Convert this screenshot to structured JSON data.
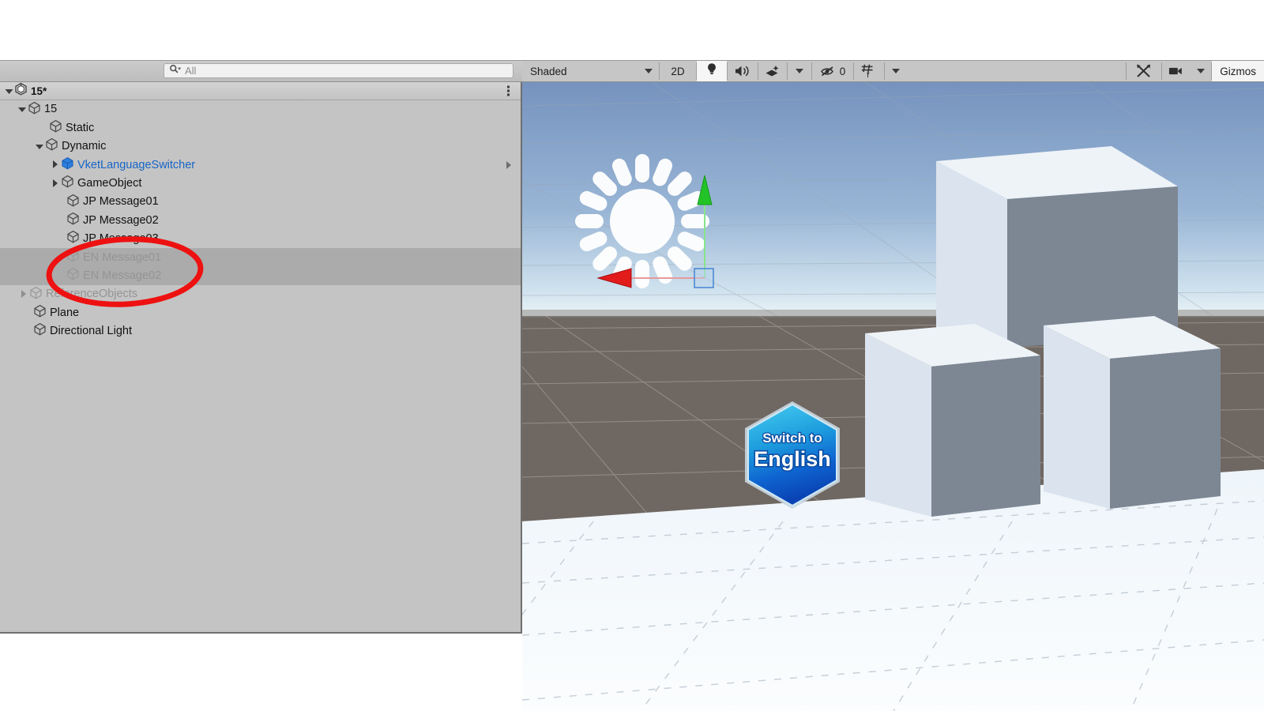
{
  "hierarchy_panel": {
    "search": {
      "value": "All",
      "placeholder": "All",
      "icon": "search-icon"
    },
    "scene_header": {
      "title": "15*",
      "icon": "unity-scene-icon",
      "menu_icon": "kebab-menu-icon"
    },
    "items": [
      {
        "label": "15",
        "indent": 22,
        "twisty": "down",
        "state": "normal",
        "icon": "gameobject-cube-icon"
      },
      {
        "label": "Static",
        "indent": 62,
        "twisty": "none",
        "state": "normal",
        "icon": "gameobject-cube-icon"
      },
      {
        "label": "Dynamic",
        "indent": 44,
        "twisty": "down",
        "state": "normal",
        "icon": "gameobject-cube-icon"
      },
      {
        "label": "VketLanguageSwitcher",
        "indent": 64,
        "twisty": "right",
        "state": "prefab",
        "icon": "prefab-cube-icon"
      },
      {
        "label": "GameObject",
        "indent": 64,
        "twisty": "right",
        "state": "normal",
        "icon": "gameobject-cube-icon"
      },
      {
        "label": "JP Message01",
        "indent": 84,
        "twisty": "none",
        "state": "normal",
        "icon": "gameobject-cube-icon"
      },
      {
        "label": "JP Message02",
        "indent": 84,
        "twisty": "none",
        "state": "normal",
        "icon": "gameobject-cube-icon"
      },
      {
        "label": "JP Message03",
        "indent": 84,
        "twisty": "none",
        "state": "normal",
        "icon": "gameobject-cube-icon"
      },
      {
        "label": "EN Message01",
        "indent": 84,
        "twisty": "none",
        "state": "disabled-selected",
        "icon": "gameobject-cube-icon"
      },
      {
        "label": "EN Message02",
        "indent": 84,
        "twisty": "none",
        "state": "disabled-selected",
        "icon": "gameobject-cube-icon"
      },
      {
        "label": "ReferenceObjects",
        "indent": 24,
        "twisty": "right",
        "state": "disabled",
        "icon": "gameobject-cube-icon"
      },
      {
        "label": "Plane",
        "indent": 42,
        "twisty": "none",
        "state": "normal",
        "icon": "gameobject-cube-icon"
      },
      {
        "label": "Directional Light",
        "indent": 42,
        "twisty": "none",
        "state": "normal",
        "icon": "gameobject-cube-icon"
      }
    ]
  },
  "scene_toolbar": {
    "shading_mode": "Shaded",
    "view_mode_2d": "2D",
    "lighting_icon": "lightbulb-icon",
    "audio_icon": "speaker-icon",
    "effects_icon": "fx-layers-icon",
    "effects_dropdown_icon": "chevron-down-icon",
    "hidden_objects_icon": "eye-slash-icon",
    "hidden_objects_count": "0",
    "grid_icon": "grid-snap-icon",
    "grid_dropdown_icon": "chevron-down-icon",
    "tools_icon": "tools-icon",
    "camera_icon": "camera-icon",
    "camera_dropdown_icon": "chevron-down-icon",
    "gizmos_label": "Gizmos"
  },
  "scene_view": {
    "light_gizmo_icon": "directional-light-sun-icon",
    "move_gizmo": {
      "y_axis_color": "#26c42a",
      "x_axis_color": "#e02020"
    },
    "hex_button": {
      "line1": "Switch to",
      "line2": "English",
      "color_top": "#3bc0e8",
      "color_bottom": "#0a4fc8"
    },
    "sky_top_color": "#7593be",
    "sky_horizon_color": "#dfeaf2",
    "ground_color": "#6f6761",
    "plane_color": "#f4f8fb",
    "cube_top_color": "#eef3f8",
    "cube_left_color": "#d9e2ec",
    "cube_right_color": "#7d8794"
  },
  "annotation": {
    "shape": "ellipse",
    "color": "#ee1111",
    "target": "EN Message01 / EN Message02"
  }
}
